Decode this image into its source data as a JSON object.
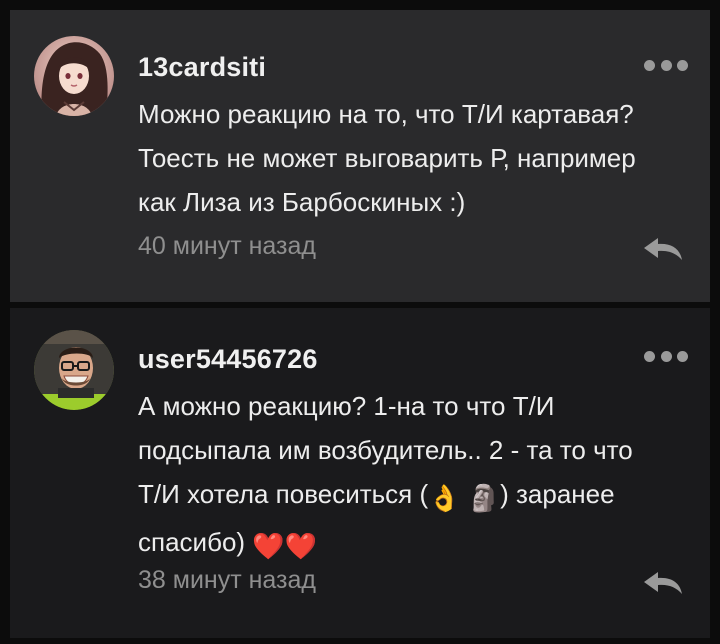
{
  "comments": [
    {
      "username": "13cardsiti",
      "text": "Можно реакцию на то, что Т/И картавая?\nТоесть не может выговарить Р, например\nкак Лиза из Барбоскиных :)",
      "time": "40 минут назад",
      "avatar_icon": "anime-girl-avatar",
      "menu_icon": "more-dots-icon",
      "reply_icon": "reply-arrow-icon"
    },
    {
      "username": "user54456726",
      "text_parts": {
        "line1": "А можно реакцию? 1-на то что Т/И",
        "line2": "подсыпала им возбудитель.. 2 - та то что",
        "line3_before": "Т/И хотела повеситься (",
        "line3_after": ") заранее",
        "line4": "спасибо) "
      },
      "emojis": [
        "👌",
        "🗿",
        "❤️",
        "❤️"
      ],
      "time": "38 минут назад",
      "avatar_icon": "man-with-glasses-avatar",
      "menu_icon": "more-dots-icon",
      "reply_icon": "reply-arrow-icon"
    }
  ],
  "colors": {
    "background": "#0c0c0c",
    "comment_highlight": "#2a2a2c",
    "comment_normal": "#1a1a1c",
    "text": "#ededed",
    "muted": "#8f8f8f",
    "avatar2_ring": "#9ccc2c"
  }
}
